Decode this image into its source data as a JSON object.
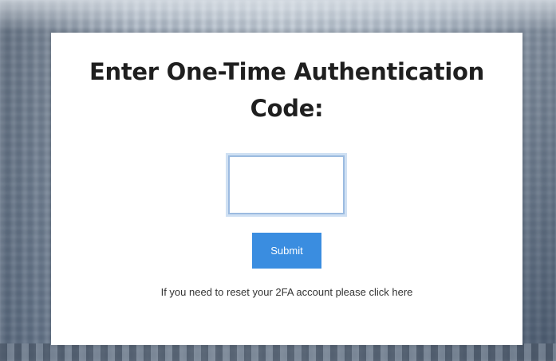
{
  "page": {
    "title": "Enter One-Time Authentication Code:"
  },
  "form": {
    "code_value": "",
    "code_placeholder": "",
    "submit_label": "Submit"
  },
  "reset": {
    "prefix_text": "If you need to reset your 2FA account please ",
    "link_text": "click here"
  },
  "colors": {
    "accent": "#3a8de0",
    "card_background": "#ffffff",
    "input_focus_border": "#9cbbe0"
  }
}
